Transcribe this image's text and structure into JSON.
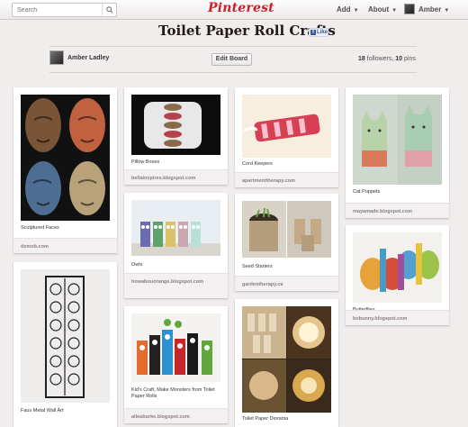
{
  "header": {
    "search_placeholder": "Search",
    "logo": "Pinterest",
    "nav": [
      {
        "label": "Add"
      },
      {
        "label": "About"
      },
      {
        "label": "Amber"
      }
    ]
  },
  "board": {
    "title": "Toilet Paper Roll Crafts",
    "fb_like": "Like",
    "owner": "Amber Ladley",
    "edit_label": "Edit Board",
    "followers": "18",
    "followers_label": "followers,",
    "pins": "10",
    "pins_label": "pins"
  },
  "pins": [
    {
      "desc": "Sculptured Faces",
      "source": "demob.com"
    },
    {
      "desc": "Faux Metal Wall Art",
      "source": ""
    },
    {
      "desc": "Pillow Boxes",
      "source": "bellainspires.blogspot.com"
    },
    {
      "desc": "Owls",
      "source": "howabouorange.blogspot.com"
    },
    {
      "desc": "Kid's Craft, Make Monsters from Toilet Paper Rolls",
      "source": "alleaburke.blogspot.com"
    },
    {
      "desc": "Cord Keepers",
      "source": "apartmenttherapy.com"
    },
    {
      "desc": "Seed Starters",
      "source": "gardentherapy.ca"
    },
    {
      "desc": "Toilet Paper Diorama",
      "source": ""
    },
    {
      "desc": "Cat Puppets",
      "source": "mayamade.blogspot.com"
    },
    {
      "desc": "Butterflies",
      "source": "bobunny.blogspot.com"
    }
  ],
  "colors": {
    "brand": "#cb2027",
    "background": "#f0edec",
    "fb": "#3b5998"
  }
}
